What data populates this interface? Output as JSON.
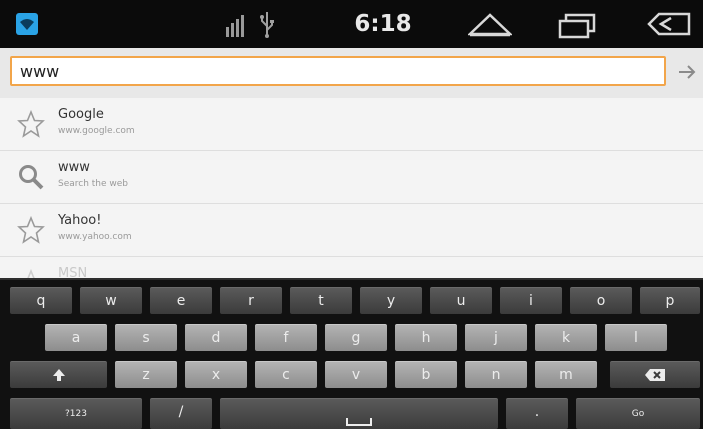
{
  "status_bar": {
    "time": "6:18"
  },
  "url_bar": {
    "value": "www"
  },
  "suggestions": [
    {
      "title": "Google",
      "subtitle": "www.google.com",
      "icon": "star-icon"
    },
    {
      "title": "www",
      "subtitle": "Search the web",
      "icon": "search-icon"
    },
    {
      "title": "Yahoo!",
      "subtitle": "www.yahoo.com",
      "icon": "star-icon"
    },
    {
      "title": "MSN",
      "subtitle": "",
      "icon": "star-icon"
    }
  ],
  "keyboard": {
    "row1": [
      "q",
      "w",
      "e",
      "r",
      "t",
      "y",
      "u",
      "i",
      "o",
      "p"
    ],
    "row2": [
      "a",
      "s",
      "d",
      "f",
      "g",
      "h",
      "j",
      "k",
      "l"
    ],
    "row3": [
      "z",
      "x",
      "c",
      "v",
      "b",
      "n",
      "m"
    ],
    "symbols_label": "?123",
    "slash_label": "/",
    "dot_label": ".",
    "go_label": "Go"
  },
  "colors": {
    "accent_focus": "#f2a54a",
    "wifi": "#2aa3e6"
  }
}
